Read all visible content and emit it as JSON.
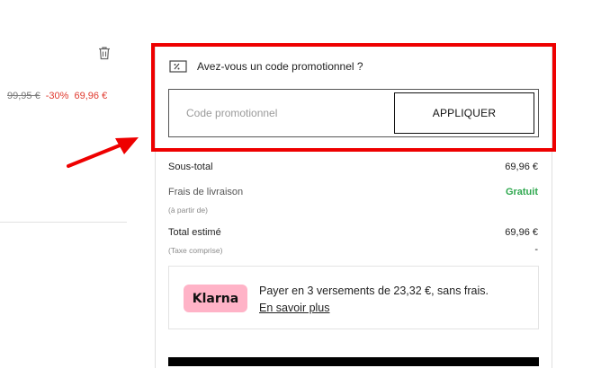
{
  "product": {
    "old_price": "99,95 €",
    "discount": "-30%",
    "new_price": "69,96 €",
    "delete_icon": "trash-icon"
  },
  "promo": {
    "icon": "coupon-icon",
    "title": "Avez-vous un code promotionnel ?",
    "placeholder": "Code promotionnel",
    "value": "",
    "apply_label": "APPLIQUER",
    "highlight_color": "#ee0000"
  },
  "summary": {
    "subtotal_label": "Sous-total",
    "subtotal_value": "69,96 €",
    "shipping_label": "Frais de livraison",
    "shipping_value": "Gratuit",
    "shipping_note": "(à partir de)",
    "total_label": "Total estimé",
    "total_value": "69,96 €",
    "total_note": "(Taxe comprise)",
    "tax_value": "-",
    "free_color": "#2fa84f"
  },
  "klarna": {
    "logo": "Klarna",
    "message": "Payer en 3 versements de 23,32 €, sans frais.",
    "link": "En savoir plus",
    "badge_color": "#ffb3c7"
  },
  "annotation": {
    "arrow_color": "#ee0000"
  }
}
